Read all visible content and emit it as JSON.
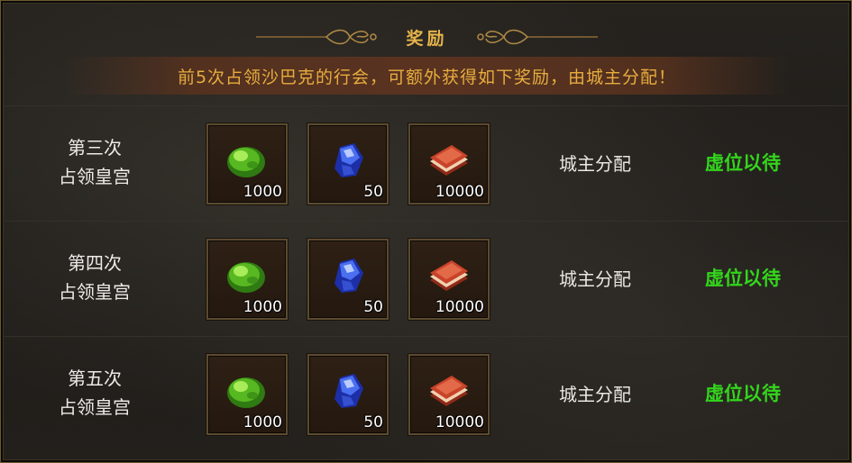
{
  "header": {
    "title": "奖励"
  },
  "banner": {
    "text": "前5次占领沙巴克的行会，可额外获得如下奖励，由城主分配！"
  },
  "rows": [
    {
      "label_line1": "第三次",
      "label_line2": "占领皇宫",
      "rewards": [
        {
          "icon": "green-jade-icon",
          "qty": "1000"
        },
        {
          "icon": "blue-crystal-icon",
          "qty": "50"
        },
        {
          "icon": "red-book-icon",
          "qty": "10000"
        }
      ],
      "allocation": "城主分配",
      "status": "虚位以待"
    },
    {
      "label_line1": "第四次",
      "label_line2": "占领皇宫",
      "rewards": [
        {
          "icon": "green-jade-icon",
          "qty": "1000"
        },
        {
          "icon": "blue-crystal-icon",
          "qty": "50"
        },
        {
          "icon": "red-book-icon",
          "qty": "10000"
        }
      ],
      "allocation": "城主分配",
      "status": "虚位以待"
    },
    {
      "label_line1": "第五次",
      "label_line2": "占领皇宫",
      "rewards": [
        {
          "icon": "green-jade-icon",
          "qty": "1000"
        },
        {
          "icon": "blue-crystal-icon",
          "qty": "50"
        },
        {
          "icon": "red-book-icon",
          "qty": "10000"
        }
      ],
      "allocation": "城主分配",
      "status": "虚位以待"
    }
  ],
  "colors": {
    "title": "#e5b34a",
    "banner_text": "#e7ad3e",
    "status": "#33d61c",
    "frame": "#6b5a33"
  }
}
